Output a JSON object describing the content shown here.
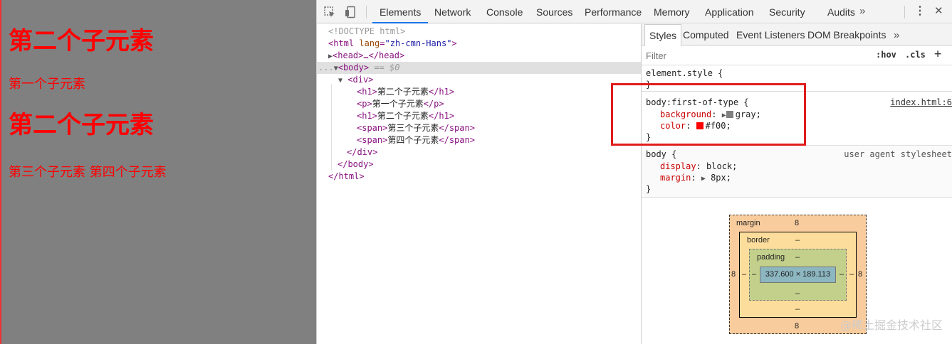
{
  "preview": {
    "h1_first": "第二个子元素",
    "p": "第一个子元素",
    "h1_second": "第二个子元素",
    "span_a": "第三个子元素",
    "span_b": "第四个子元素"
  },
  "toolbar": {
    "tabs": [
      "Elements",
      "Network",
      "Console",
      "Sources",
      "Performance",
      "Memory",
      "Application",
      "Security",
      "Audits"
    ],
    "more": "»",
    "menu": "⋮",
    "close": "✕"
  },
  "dom": {
    "doctype": "<!DOCTYPE html>",
    "html_open": "<html",
    "html_attr": "lang",
    "html_val": "\"zh-cmn-Hans\"",
    "head": "<head>…</head>",
    "body_open": "<body>",
    "body_eq": "== $0",
    "dots": "...",
    "div_open": "<div>",
    "h1_open": "<h1>",
    "h1_text": "第二个子元素",
    "h1_close": "</h1>",
    "p_open": "<p>",
    "p_text": "第一个子元素",
    "p_close": "</p>",
    "h1b_text": "第二个子元素",
    "span_open": "<span>",
    "span_a_text": "第三个子元素",
    "span_close": "</span>",
    "span_b_text": "第四个子元素",
    "div_close": "</div>",
    "body_close": "</body>",
    "html_close": "</html>"
  },
  "styles": {
    "subtabs": [
      "Styles",
      "Computed",
      "Event Listeners",
      "DOM Breakpoints"
    ],
    "more": "»",
    "filter_placeholder": "Filter",
    "hov": ":hov",
    "cls": ".cls",
    "plus": "+",
    "element_style": "element.style {",
    "close_brace": "}",
    "rule1_selector": "body:first-of-type {",
    "rule1_source": "index.html:6",
    "rule1_p1_name": "background",
    "rule1_p1_value": "gray;",
    "rule1_p2_name": "color",
    "rule1_p2_value": "#f00;",
    "rule2_selector": "body {",
    "rule2_source": "user agent stylesheet",
    "rule2_p1_name": "display",
    "rule2_p1_value": "block;",
    "rule2_p2_name": "margin",
    "rule2_p2_value": "8px;",
    "swatch_gray": "#808080",
    "swatch_red": "#ff0000"
  },
  "boxmodel": {
    "margin_label": "margin",
    "margin_top": "8",
    "margin_bottom": "8",
    "margin_left": "8",
    "margin_right": "8",
    "border_label": "border",
    "border_top": "–",
    "border_bottom": "–",
    "border_left": "–",
    "border_right": "–",
    "padding_label": "padding",
    "padding_top": "–",
    "padding_bottom": "–",
    "padding_left": "–",
    "padding_right": "–",
    "content": "337.600 × 189.113"
  },
  "watermark": "@稀土掘金技术社区"
}
